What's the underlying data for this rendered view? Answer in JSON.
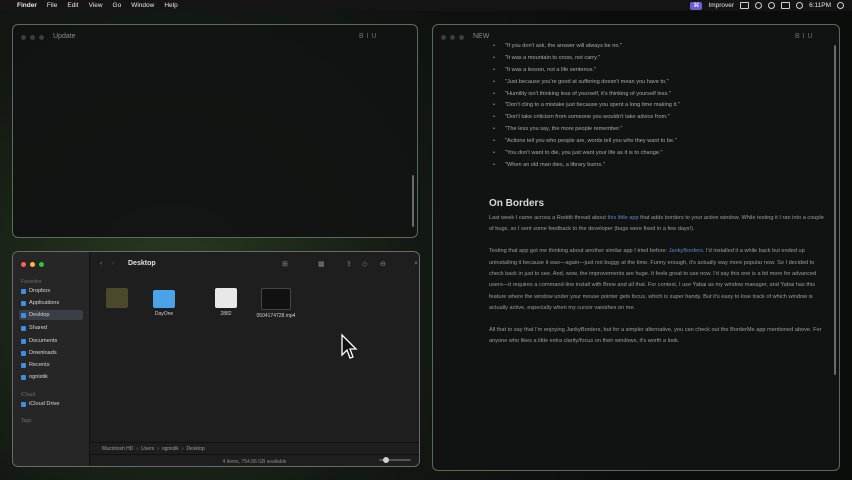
{
  "menubar": {
    "app": "Finder",
    "items": [
      "File",
      "Edit",
      "View",
      "Go",
      "Window",
      "Help"
    ],
    "badge": "Improver",
    "clock": "6:11PM"
  },
  "update_window": {
    "title": "Update",
    "format_label": "B I U"
  },
  "new_window": {
    "title": "NEW",
    "format_label": "B I U",
    "quotes": [
      "\"If you don't ask, the answer will always be no.\"",
      "\"It was a mountain to cross, not carry.\"",
      "\"It was a lesson, not a life sentence.\"",
      "\"Just because you're good at suffering doesn't mean you have to.\"",
      "\"Humility isn't thinking less of yourself, it's thinking of yourself less.\"",
      "\"Don't cling to a mistake just because you spent a long time making it.\"",
      "\"Don't take criticism from someone you wouldn't take advice from.\"",
      "\"The less you say, the more people remember.\"",
      "\"Actions tell you who people are, words tell you who they want to be.\"",
      "\"You don't want to die, you just want your life as it is to change.\"",
      "\"When an old man dies, a library burns.\""
    ],
    "heading": "On Borders",
    "p1_a": "Last week I came across a Reddit thread about ",
    "p1_link": "this little app",
    "p1_b": " that adds borders to your active window. While testing it I ran into a couple of bugs, so I sent some feedback to the developer (bugs were fixed in a few days!).",
    "p2_a": "Testing that app got me thinking about another similar app I tried before: ",
    "p2_link": "JankyBorders",
    "p2_b": ". I'd installed it a while back but ended up uninstalling it because it was—again—just not buggy at the time. Funny enough, it's actually way more popular now. So I decided to check back in just to see. And, wow, the improvements are huge. It feels great to use now. I'd say this one is a bit more for advanced users—it requires a command-line install with Brew and all that. For context, I use Yabai as my window manager, and Yabai has this feature where the window under your mouse pointer gets focus, which is super handy. But it's easy to lose track of which window is actually active, especially when my cursor vanishes on me.",
    "p3": "All that to say that I'm enjoying JankyBorders, but for a simpler alternative, you can check out the BorderMe app mentioned above. For anyone who likes a little extra clarity/focus on their windows, it's worth a look."
  },
  "finder": {
    "title": "Desktop",
    "favorites_label": "Favorites",
    "icloud_label": "iCloud",
    "tags_label": "Tags",
    "sidebar": [
      {
        "label": "Dropbox",
        "selected": false
      },
      {
        "label": "Applications",
        "selected": false
      },
      {
        "label": "Desktop",
        "selected": true
      },
      {
        "label": "Shared",
        "selected": false
      },
      {
        "label": "Documents",
        "selected": false
      },
      {
        "label": "Downloads",
        "selected": false
      },
      {
        "label": "Recents",
        "selected": false
      },
      {
        "label": "ognistik",
        "selected": false
      }
    ],
    "icloud_item": "iCloud Drive",
    "files": [
      {
        "name": "",
        "kind": "image"
      },
      {
        "name": "DayOne",
        "kind": "folder"
      },
      {
        "name": "2882",
        "kind": "document"
      },
      {
        "name": "0504174728.mp4",
        "kind": "video"
      }
    ],
    "path": [
      "Macintosh HD",
      "Users",
      "ognistik",
      "Desktop"
    ],
    "status": "4 items, 754.86 GB available"
  }
}
